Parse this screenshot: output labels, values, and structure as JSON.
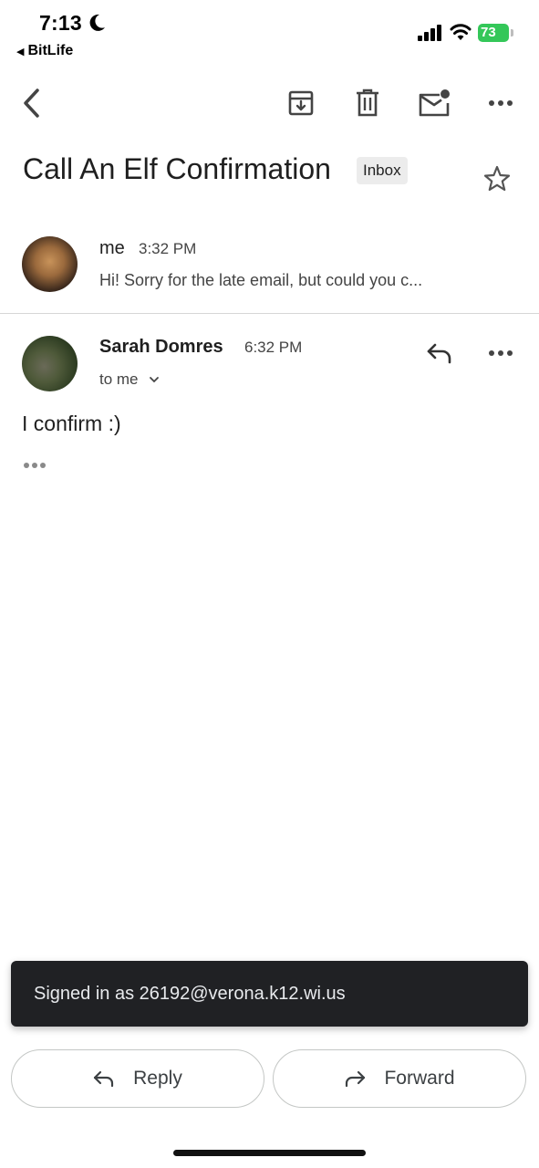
{
  "status_bar": {
    "time": "7:13",
    "back_app": "BitLife",
    "battery": "73"
  },
  "toolbar": {
    "back_icon": "chevron-left-icon",
    "archive_icon": "archive-icon",
    "delete_icon": "trash-icon",
    "unread_icon": "mark-unread-icon",
    "more_icon": "more-horizontal-icon"
  },
  "thread": {
    "subject": "Call An Elf Confirmation",
    "label": "Inbox"
  },
  "messages": [
    {
      "from": "me",
      "time": "3:32 PM",
      "snippet": "Hi! Sorry for the late email, but could you c..."
    },
    {
      "from": "Sarah Domres",
      "time": "6:32 PM",
      "to": "to me",
      "body": "I confirm :)"
    }
  ],
  "snackbar": {
    "text": "Signed in as 26192@verona.k12.wi.us"
  },
  "actions": {
    "reply": "Reply",
    "forward": "Forward"
  },
  "colors": {
    "battery": "#34c759",
    "snackbar_bg": "#202124",
    "text": "#1f1f1f"
  }
}
